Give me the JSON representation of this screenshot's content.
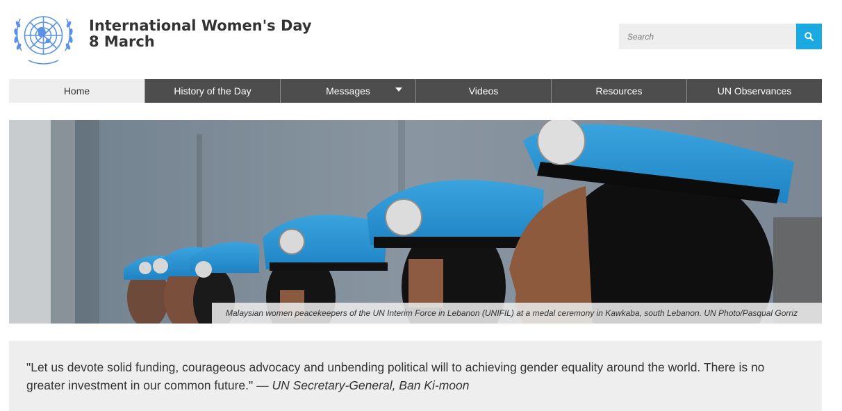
{
  "header": {
    "title_line1": "International Women's Day",
    "title_line2": "8 March",
    "logo_icon": "un-emblem-icon",
    "brand_color": "#5b92e5"
  },
  "search": {
    "placeholder": "Search",
    "button_icon": "search-icon",
    "button_color": "#1ba9e1"
  },
  "nav": {
    "items": [
      {
        "label": "Home",
        "active": true
      },
      {
        "label": "History of the Day"
      },
      {
        "label": "Messages",
        "has_dropdown": true
      },
      {
        "label": "Videos"
      },
      {
        "label": "Resources"
      },
      {
        "label": "UN Observances"
      }
    ]
  },
  "hero": {
    "caption": "Malaysian women peacekeepers of the UN Interim Force in Lebanon (UNIFIL) at a medal ceremony in Kawkaba, south Lebanon. UN Photo/Pasqual Gorriz"
  },
  "quote": {
    "text": "\"Let us devote solid funding, courageous advocacy and unbending political will to achieving gender equality around the world. There is no greater investment in our common future.\"",
    "attribution": "— UN Secretary-General, Ban Ki-moon"
  }
}
